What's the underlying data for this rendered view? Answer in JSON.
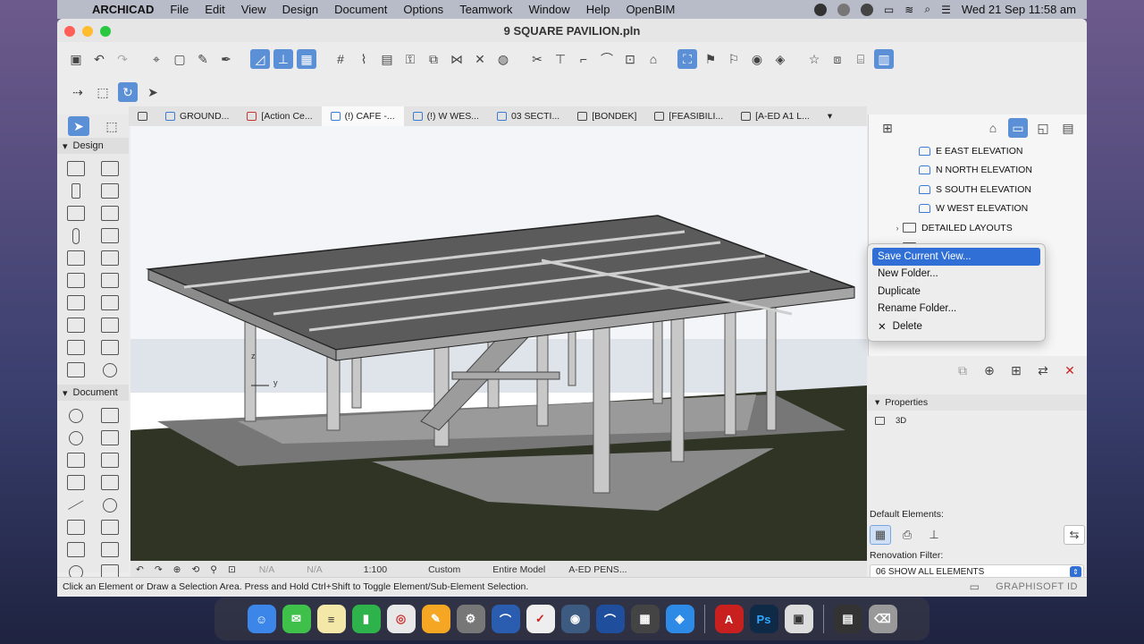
{
  "menubar": {
    "app": "ARCHICAD",
    "items": [
      "File",
      "Edit",
      "View",
      "Design",
      "Document",
      "Options",
      "Teamwork",
      "Window",
      "Help",
      "OpenBIM"
    ],
    "clock": "Wed 21 Sep  11:58 am"
  },
  "window": {
    "title": "9 SQUARE PAVILION.pln"
  },
  "tabs": [
    {
      "label": "GROUND...",
      "icon": "floor-plan-icon"
    },
    {
      "label": "[Action Ce...",
      "icon": "action-center-icon"
    },
    {
      "label": "(!) CAFE -...",
      "icon": "3d-window-icon",
      "active": true
    },
    {
      "label": "(!) W WES...",
      "icon": "elevation-icon"
    },
    {
      "label": "03 SECTI...",
      "icon": "section-icon"
    },
    {
      "label": "[BONDEK]",
      "icon": "detail-icon"
    },
    {
      "label": "[FEASIBILI...",
      "icon": "worksheet-icon"
    },
    {
      "label": "[A-ED A1 L...",
      "icon": "layout-icon"
    }
  ],
  "toolbox": {
    "design_label": "Design",
    "document_label": "Document"
  },
  "viewport": {
    "axis_label": "y",
    "z_label": "z"
  },
  "view_status": {
    "scale": "1:100",
    "na1": "N/A",
    "na2": "N/A",
    "pen": "Custom",
    "model": "Entire Model",
    "pens": "A-ED PENS..."
  },
  "hint": "Click an Element or Draw a Selection Area. Press and Hold Ctrl+Shift to Toggle Element/Sub-Element Selection.",
  "navigator": {
    "rows": [
      {
        "label": "E EAST ELEVATION",
        "kind": "view"
      },
      {
        "label": "N NORTH ELEVATION",
        "kind": "view"
      },
      {
        "label": "S SOUTH ELEVATION",
        "kind": "view"
      },
      {
        "label": "W WEST ELEVATION",
        "kind": "view"
      },
      {
        "label": "DETAILED LAYOUTS",
        "kind": "folder"
      }
    ]
  },
  "context_menu": {
    "items": [
      {
        "label": "Save Current View...",
        "selected": true
      },
      {
        "label": "New Folder..."
      },
      {
        "label": "Duplicate"
      },
      {
        "label": "Rename Folder..."
      },
      {
        "label": "Delete",
        "icon": "x-icon"
      }
    ]
  },
  "properties": {
    "header": "Properties",
    "value": "3D"
  },
  "defaults": {
    "label": "Default Elements:",
    "renovation_label": "Renovation Filter:",
    "renovation_value": "06 SHOW ALL ELEMENTS"
  },
  "brand": "GRAPHISOFT ID",
  "colors": {
    "accent": "#2f6fd6",
    "sky": "#dfe3ea",
    "ground": "#2f3425",
    "slab": "#bdbdbd"
  }
}
